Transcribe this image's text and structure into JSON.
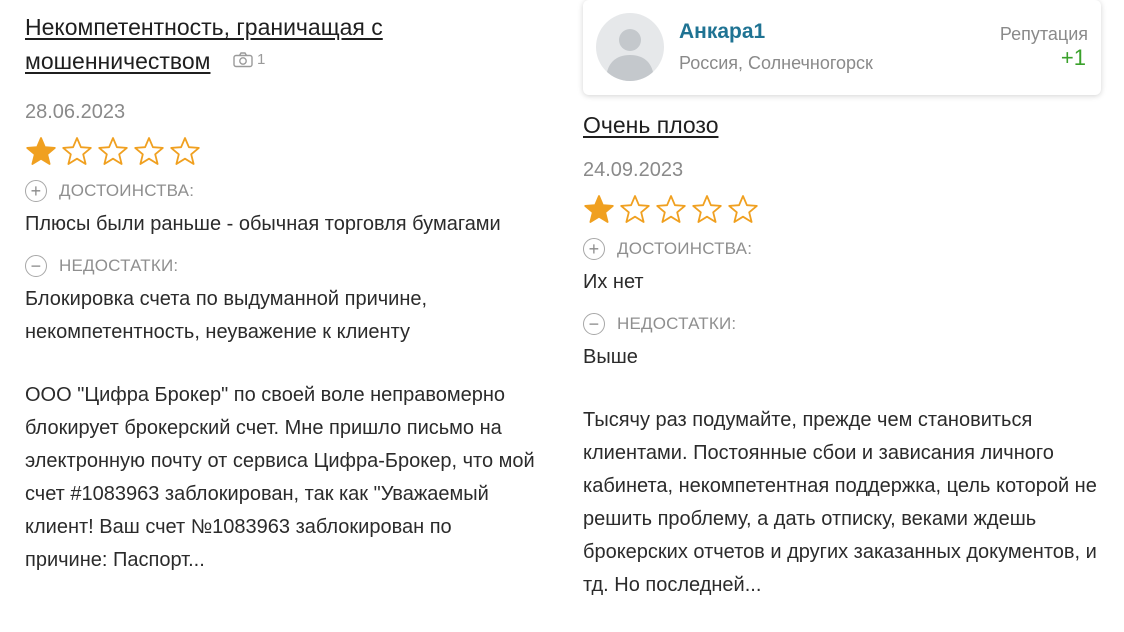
{
  "review_left": {
    "title": "Некомпетентность, граничащая с мошенничеством",
    "photo_count": "1",
    "date": "28.06.2023",
    "rating": 1,
    "pros_label": "ДОСТОИНСТВА:",
    "pros_text": "Плюсы были раньше - обычная торговля бумагами",
    "cons_label": "НЕДОСТАТКИ:",
    "cons_text": "Блокировка счета по выдуманной причине, некомпетентность, неуважение к клиенту",
    "body": "ООО \"Цифра Брокер\" по своей воле неправомерно блокирует брокерский счет. Мне пришло письмо на электронную почту от сервиса Цифра-Брокер, что мой счет #1083963 заблокирован, так как \"Уважаемый клиент! Ваш счет №1083963 заблокирован по причине: Паспорт..."
  },
  "review_right": {
    "user": {
      "name": "Анкара1",
      "location": "Россия, Солнечногорск",
      "reputation_label": "Репутация",
      "reputation_value": "+1"
    },
    "title": "Очень плозо",
    "date": "24.09.2023",
    "rating": 1,
    "pros_label": "ДОСТОИНСТВА:",
    "pros_text": "Их нет",
    "cons_label": "НЕДОСТАТКИ:",
    "cons_text": "Выше",
    "body": "Тысячу раз подумайте, прежде чем становиться клиентами. Постоянные сбои и зависания личного кабинета, некомпетентная поддержка, цель которой не решить проблему, а дать отписку, веками ждешь брокерских отчетов и других заказанных документов, и тд. Но последней..."
  },
  "colors": {
    "star": "#f0a020",
    "username": "#1f7393",
    "reputation": "#3aa12b"
  }
}
